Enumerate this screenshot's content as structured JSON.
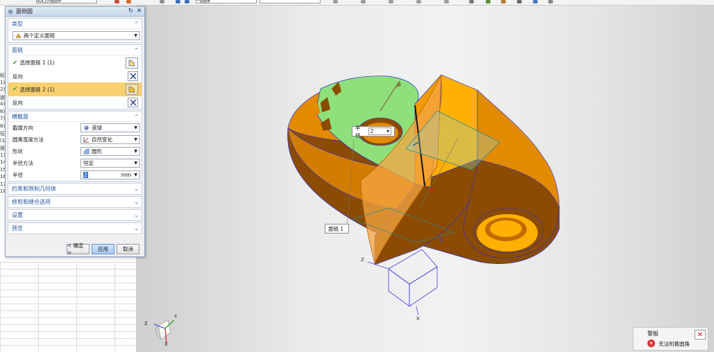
{
  "toolbar": {
    "field_text": "夹具上的面圆特",
    "combo_text": "一般面板"
  },
  "navigator": {
    "letters": [
      "标",
      "1)",
      "2)",
      "面",
      "4)",
      "6)",
      "7)",
      "8)",
      "征",
      "(1",
      "面",
      "13",
      "14",
      "15",
      "16",
      "17",
      "18"
    ]
  },
  "dialog": {
    "title": "面倒圆",
    "groups": {
      "type": {
        "title": "类型",
        "value": "两个定义面链"
      },
      "face_chain": {
        "title": "面链",
        "select1": "选择面链 1 (1)",
        "reverse1": "反向",
        "select2": "选择面链 2 (1)",
        "reverse2": "反向"
      },
      "cross_section": {
        "title": "横截面",
        "section_dir_label": "截面方向",
        "section_dir_value": "滚球",
        "width_method_label": "圆角宽度方法",
        "width_method_value": "自然变化",
        "shape_label": "形状",
        "shape_value": "圆形",
        "radius_method_label": "半径方法",
        "radius_method_value": "恒定",
        "radius_label": "半径",
        "radius_value": "2",
        "radius_unit": "mm"
      },
      "constraints": {
        "title": "约束和限制几何体"
      },
      "trim": {
        "title": "修剪和缝合选项"
      },
      "settings": {
        "title": "设置"
      },
      "preview": {
        "title": "预览"
      }
    },
    "buttons": {
      "ok": "< 确定 >",
      "apply": "应用",
      "cancel": "取消"
    }
  },
  "graphics": {
    "radius_tag_label": "半径",
    "radius_tag_value": "2",
    "face_chain_tag": "面链 1",
    "axis_z": "Z",
    "axis_x": "X",
    "triad_z": "Z",
    "triad_y": "Y",
    "triad_x": "X"
  },
  "alert": {
    "title": "警报",
    "message": "无法附着圆角",
    "close": "✕"
  },
  "colors": {
    "part_orange": "#e28a00",
    "part_dark": "#8b4b00",
    "face_green": "#8ee07b",
    "accent_blue": "#2457a1",
    "highlight": "#f8d070"
  }
}
